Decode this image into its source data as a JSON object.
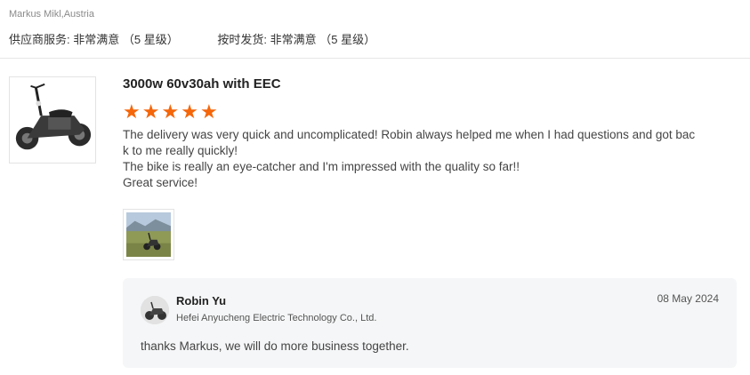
{
  "reviewer": {
    "name_location": "Markus Mikl,Austria"
  },
  "ratings": [
    {
      "label": "供应商服务:",
      "value": "非常满意",
      "stars": "（5 星级）"
    },
    {
      "label": "按时发货:",
      "value": "非常满意",
      "stars": "（5 星级）"
    }
  ],
  "review": {
    "product_title": "3000w 60v30ah with EEC",
    "rating": 5,
    "star_color": "#f5660a",
    "lines": [
      "The delivery was very quick and uncomplicated! Robin always helped me when I had questions and got bac",
      "k to me really quickly!",
      "The bike is really an eye-catcher and I'm impressed with the quality so far!!",
      "Great service!"
    ]
  },
  "reply": {
    "name": "Robin Yu",
    "company": "Hefei Anyucheng Electric Technology Co., Ltd.",
    "date": "08 May 2024",
    "text": "thanks Markus, we will do more business together."
  }
}
